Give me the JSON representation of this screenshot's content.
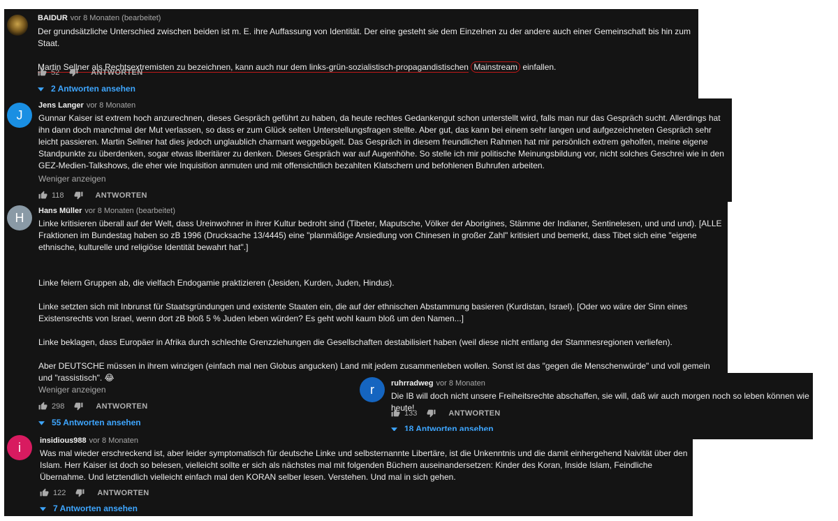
{
  "common": {
    "reply_label": "ANTWORTEN"
  },
  "comments": [
    {
      "author": "BAIDUR",
      "meta": "vor 8 Monaten (bearbeitet)",
      "paragraphs": [
        "Der grundsätzliche Unterschied zwischen beiden ist m. E. ihre Auffassung von Identität. Der eine gesteht sie dem Einzelnen zu der andere auch einer Gemeinschaft bis hin zum Staat.",
        "Martin Sellner als Rechtsextremisten zu bezeichnen, kann auch nur dem links-grün-sozialistisch-propagandistischen",
        "Mainstream",
        "einfallen."
      ],
      "likes": "52",
      "replies": "2 Antworten ansehen"
    },
    {
      "author": "Jens Langer",
      "meta": "vor 8 Monaten",
      "avatar_letter": "J",
      "avatar_color": "#1a8fe3",
      "text": "Gunnar Kaiser ist extrem hoch anzurechnen, dieses Gespräch geführt zu haben, da heute rechtes Gedankengut schon unterstellt wird, falls man nur das Gespräch sucht. Allerdings hat ihn dann doch manchmal der Mut verlassen, so dass er zum Glück selten Unterstellungsfragen stellte. Aber gut, das kann bei einem sehr langen und aufgezeichneten Gespräch sehr leicht passieren. Martin Sellner hat dies jedoch unglaublich charmant weggebügelt. Das Gespräch in diesem freundlichen Rahmen hat mir persönlich extrem geholfen, meine eigene Standpunkte zu überdenken, sogar etwas liberitärer zu denken. Dieses Gespräch war auf Augenhöhe. So stelle ich mir politische Meinungsbildung vor, nicht solches Geschrei wie in den GEZ-Medien-Talkshows, die eher wie Inquisition anmuten und mit offensichtlich bezahlten Klatschern und befohlenen Buhrufen arbeiten.",
      "more": "Weniger anzeigen",
      "likes": "118"
    },
    {
      "author": "Hans Müller",
      "meta": "vor 8 Monaten (bearbeitet)",
      "avatar_letter": "H",
      "avatar_color": "#8a9aa6",
      "text": "Linke kritisieren überall auf der Welt, dass Ureinwohner in ihrer Kultur bedroht sind (Tibeter, Maputsche,  Völker der Aborigines, Stämme der Indianer, Sentinelesen, und und und). [ALLE Fraktionen im Bundestag haben so zB 1996 (Drucksache 13/4445) eine \"planmäßige Ansiedlung von Chinesen in großer Zahl\" kritisiert und bemerkt, dass Tibet sich eine \"eigene ethnische, kulturelle und religiöse Identität bewahrt hat\".]\n\n\nLinke feiern Gruppen ab, die vielfach Endogamie praktizieren (Jesiden, Kurden, Juden, Hindus).\n\nLinke setzten sich mit Inbrunst für Staatsgründungen und existente Staaten ein, die auf der ethnischen Abstammung basieren (Kurdistan, Israel). [Oder wo wäre der Sinn eines Existensrechts von Israel, wenn dort zB bloß 5 % Juden leben würden? Es geht wohl kaum bloß um den Namen...]\n\nLinke beklagen, dass Europäer in Afrika durch schlechte Grenzziehungen die Gesellschaften destabilisiert haben (weil diese nicht entlang der Stammesregionen verliefen).\n\nAber DEUTSCHE müssen in ihrem winzigen (einfach mal nen Globus angucken) Land mit jedem zusammenleben wollen. Sonst ist das \"gegen die Menschenwürde\" und voll gemein und \"rassistisch\". 😂",
      "more": "Weniger anzeigen",
      "likes": "298",
      "replies": "55 Antworten ansehen"
    },
    {
      "author": "ruhrradweg",
      "meta": "vor 8 Monaten",
      "avatar_letter": "r",
      "avatar_color": "#1565c0",
      "text": "Die IB will doch nicht unsere Freiheitsrechte abschaffen, sie will, daß wir auch morgen noch so leben können wie heute!",
      "likes": "133",
      "replies": "18 Antworten ansehen"
    },
    {
      "author": "insidious988",
      "meta": "vor 8 Monaten",
      "avatar_letter": "i",
      "avatar_color": "#d81b60",
      "text": "Was mal wieder erschreckend ist, aber leider symptomatisch für deutsche Linke und selbsternannte Libertäre, ist die Unkenntnis und die damit einhergehend Naivität über den Islam. Herr Kaiser ist doch so belesen, vielleicht sollte er sich als nächstes mal mit folgenden Büchern auseinandersetzen:  Kinder des Koran, Inside Islam,  Feindliche Übernahme. Und letztendlich vielleicht einfach mal den KORAN selber lesen. Verstehen. Und mal in sich gehen.",
      "likes": "122",
      "replies": "7 Antworten ansehen"
    }
  ]
}
